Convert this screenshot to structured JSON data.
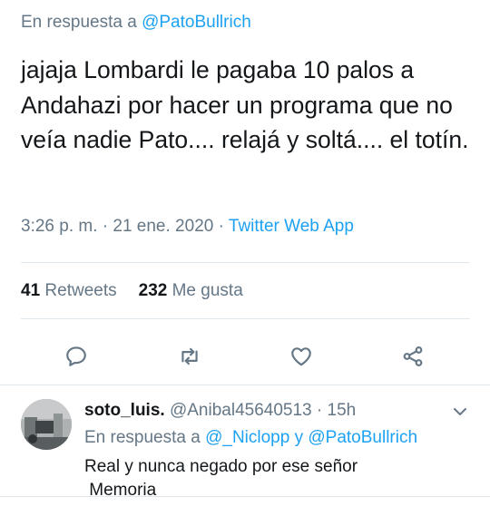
{
  "header": {
    "reply_prefix": "En respuesta a",
    "reply_handle": "@PatoBullrich"
  },
  "tweet": {
    "text": "jajaja Lombardi le pagaba 10 palos a Andahazi por hacer un programa que no veía nadie Pato.... relajá y soltá.... el totín.",
    "time": "3:26 p. m.",
    "sep1": " · ",
    "date": "21 ene. 2020",
    "sep2": " · ",
    "app": "Twitter Web App"
  },
  "stats": {
    "retweets_count": "41",
    "retweets_label": "Retweets",
    "likes_count": "232",
    "likes_label": "Me gusta"
  },
  "actions": {
    "icons": [
      "reply-icon",
      "retweet-icon",
      "like-icon",
      "share-icon"
    ],
    "icon_color": "#657786"
  },
  "reply": {
    "display_name": "soto_luis.",
    "handle": "@Anibal45640513",
    "sep": " · ",
    "time": "15h",
    "reply_prefix": "En respuesta a",
    "reply_handles": "@_Niclopp y @PatoBullrich",
    "text": "Real y nunca negado por ese señor\n Memoria"
  },
  "colors": {
    "text": "#14171a",
    "secondary": "#657786",
    "link": "#1da1f2",
    "divider": "#e1e8ed"
  }
}
